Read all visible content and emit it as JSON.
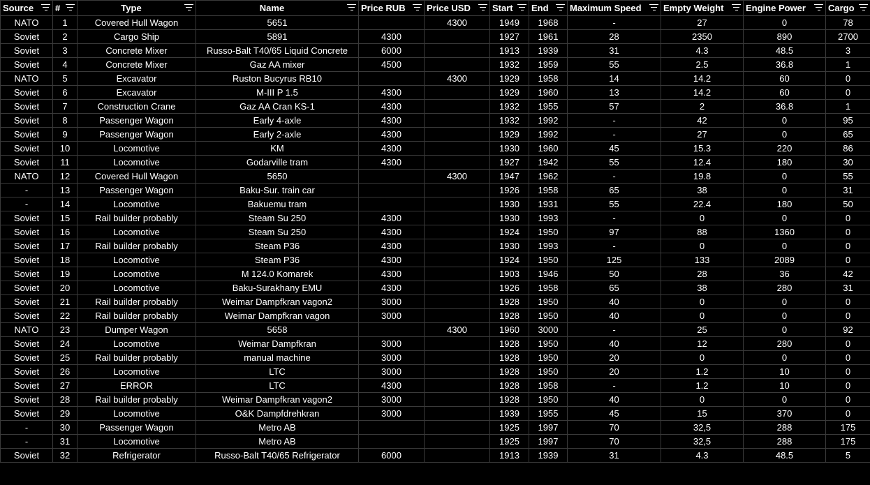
{
  "columns": [
    {
      "key": "source",
      "label": "Source"
    },
    {
      "key": "idx",
      "label": "#"
    },
    {
      "key": "type",
      "label": "Type"
    },
    {
      "key": "name",
      "label": "Name"
    },
    {
      "key": "price_rub",
      "label": "Price RUB"
    },
    {
      "key": "price_usd",
      "label": "Price USD"
    },
    {
      "key": "start",
      "label": "Start"
    },
    {
      "key": "end",
      "label": "End"
    },
    {
      "key": "max_speed",
      "label": "Maximum Speed"
    },
    {
      "key": "empty_weight",
      "label": "Empty Weight"
    },
    {
      "key": "engine_power",
      "label": "Engine Power"
    },
    {
      "key": "cargo",
      "label": "Cargo"
    }
  ],
  "rows": [
    [
      "NATO",
      "1",
      "Covered Hull Wagon",
      "5651",
      "",
      "4300",
      "1949",
      "1968",
      "-",
      "27",
      "0",
      "78"
    ],
    [
      "Soviet",
      "2",
      "Cargo Ship",
      "5891",
      "4300",
      "",
      "1927",
      "1961",
      "28",
      "2350",
      "890",
      "2700"
    ],
    [
      "Soviet",
      "3",
      "Concrete Mixer",
      "Russo-Balt T40/65 Liquid Concrete",
      "6000",
      "",
      "1913",
      "1939",
      "31",
      "4.3",
      "48.5",
      "3"
    ],
    [
      "Soviet",
      "4",
      "Concrete Mixer",
      "Gaz AA mixer",
      "4500",
      "",
      "1932",
      "1959",
      "55",
      "2.5",
      "36.8",
      "1"
    ],
    [
      "NATO",
      "5",
      "Excavator",
      "Ruston Bucyrus RB10",
      "",
      "4300",
      "1929",
      "1958",
      "14",
      "14.2",
      "60",
      "0"
    ],
    [
      "Soviet",
      "6",
      "Excavator",
      "M-III P 1.5",
      "4300",
      "",
      "1929",
      "1960",
      "13",
      "14.2",
      "60",
      "0"
    ],
    [
      "Soviet",
      "7",
      "Construction Crane",
      "Gaz AA Cran KS-1",
      "4300",
      "",
      "1932",
      "1955",
      "57",
      "2",
      "36.8",
      "1"
    ],
    [
      "Soviet",
      "8",
      "Passenger Wagon",
      "Early 4-axle",
      "4300",
      "",
      "1932",
      "1992",
      "-",
      "42",
      "0",
      "95"
    ],
    [
      "Soviet",
      "9",
      "Passenger Wagon",
      "Early 2-axle",
      "4300",
      "",
      "1929",
      "1992",
      "-",
      "27",
      "0",
      "65"
    ],
    [
      "Soviet",
      "10",
      "Locomotive",
      "KM",
      "4300",
      "",
      "1930",
      "1960",
      "45",
      "15.3",
      "220",
      "86"
    ],
    [
      "Soviet",
      "11",
      "Locomotive",
      "Godarville tram",
      "4300",
      "",
      "1927",
      "1942",
      "55",
      "12.4",
      "180",
      "30"
    ],
    [
      "NATO",
      "12",
      "Covered Hull Wagon",
      "5650",
      "",
      "4300",
      "1947",
      "1962",
      "-",
      "19.8",
      "0",
      "55"
    ],
    [
      "-",
      "13",
      "Passenger Wagon",
      "Baku-Sur. train car",
      "",
      "",
      "1926",
      "1958",
      "65",
      "38",
      "0",
      "31"
    ],
    [
      "-",
      "14",
      "Locomotive",
      "Bakuemu tram",
      "",
      "",
      "1930",
      "1931",
      "55",
      "22.4",
      "180",
      "50"
    ],
    [
      "Soviet",
      "15",
      "Rail builder probably",
      "Steam Su 250",
      "4300",
      "",
      "1930",
      "1993",
      "-",
      "0",
      "0",
      "0"
    ],
    [
      "Soviet",
      "16",
      "Locomotive",
      "Steam Su 250",
      "4300",
      "",
      "1924",
      "1950",
      "97",
      "88",
      "1360",
      "0"
    ],
    [
      "Soviet",
      "17",
      "Rail builder probably",
      "Steam P36",
      "4300",
      "",
      "1930",
      "1993",
      "-",
      "0",
      "0",
      "0"
    ],
    [
      "Soviet",
      "18",
      "Locomotive",
      "Steam P36",
      "4300",
      "",
      "1924",
      "1950",
      "125",
      "133",
      "2089",
      "0"
    ],
    [
      "Soviet",
      "19",
      "Locomotive",
      "M 124.0 Komarek",
      "4300",
      "",
      "1903",
      "1946",
      "50",
      "28",
      "36",
      "42"
    ],
    [
      "Soviet",
      "20",
      "Locomotive",
      "Baku-Surakhany EMU",
      "4300",
      "",
      "1926",
      "1958",
      "65",
      "38",
      "280",
      "31"
    ],
    [
      "Soviet",
      "21",
      "Rail builder probably",
      "Weimar Dampfkran vagon2",
      "3000",
      "",
      "1928",
      "1950",
      "40",
      "0",
      "0",
      "0"
    ],
    [
      "Soviet",
      "22",
      "Rail builder probably",
      "Weimar Dampfkran vagon",
      "3000",
      "",
      "1928",
      "1950",
      "40",
      "0",
      "0",
      "0"
    ],
    [
      "NATO",
      "23",
      "Dumper Wagon",
      "5658",
      "",
      "4300",
      "1960",
      "3000",
      "-",
      "25",
      "0",
      "92"
    ],
    [
      "Soviet",
      "24",
      "Locomotive",
      "Weimar Dampfkran",
      "3000",
      "",
      "1928",
      "1950",
      "40",
      "12",
      "280",
      "0"
    ],
    [
      "Soviet",
      "25",
      "Rail builder probably",
      "manual machine",
      "3000",
      "",
      "1928",
      "1950",
      "20",
      "0",
      "0",
      "0"
    ],
    [
      "Soviet",
      "26",
      "Locomotive",
      "LTC",
      "3000",
      "",
      "1928",
      "1950",
      "20",
      "1.2",
      "10",
      "0"
    ],
    [
      "Soviet",
      "27",
      "ERROR",
      "LTC",
      "4300",
      "",
      "1928",
      "1958",
      "-",
      "1.2",
      "10",
      "0"
    ],
    [
      "Soviet",
      "28",
      "Rail builder probably",
      "Weimar Dampfkran vagon2",
      "3000",
      "",
      "1928",
      "1950",
      "40",
      "0",
      "0",
      "0"
    ],
    [
      "Soviet",
      "29",
      "Locomotive",
      "O&K Dampfdrehkran",
      "3000",
      "",
      "1939",
      "1955",
      "45",
      "15",
      "370",
      "0"
    ],
    [
      "-",
      "30",
      "Passenger Wagon",
      "Metro AB",
      "",
      "",
      "1925",
      "1997",
      "70",
      "32,5",
      "288",
      "175"
    ],
    [
      "-",
      "31",
      "Locomotive",
      "Metro AB",
      "",
      "",
      "1925",
      "1997",
      "70",
      "32,5",
      "288",
      "175"
    ],
    [
      "Soviet",
      "32",
      "Refrigerator",
      "Russo-Balt T40/65 Refrigerator",
      "6000",
      "",
      "1913",
      "1939",
      "31",
      "4.3",
      "48.5",
      "5"
    ]
  ]
}
